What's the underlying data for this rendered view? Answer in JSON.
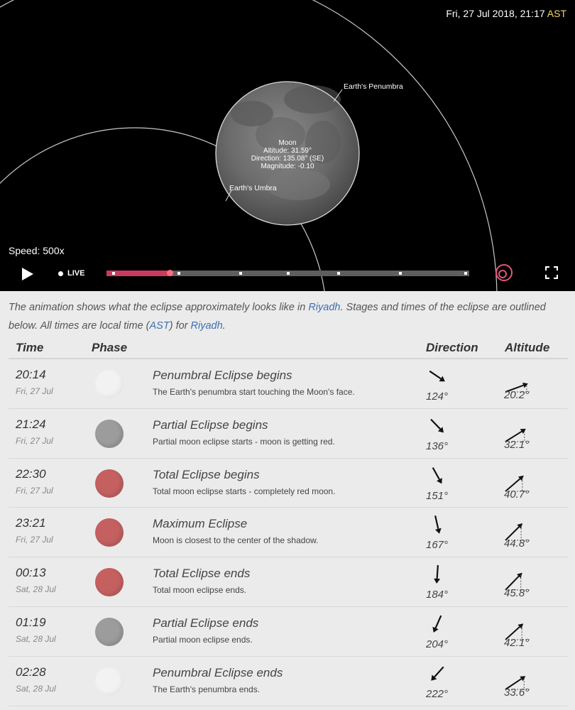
{
  "player": {
    "date_time": "Fri, 27 Jul 2018, 21:17",
    "timezone": "AST",
    "speed_label": "Speed: 500x",
    "live_label": "LIVE",
    "progress": 0.175,
    "timeline_ticks": [
      0.02,
      0.2,
      0.37,
      0.5,
      0.64,
      0.81,
      0.99
    ],
    "labels": {
      "penumbra": "Earth's Penumbra",
      "umbra": "Earth's Umbra",
      "moon_name": "Moon",
      "moon_altitude": "Altitude: 31.59°",
      "moon_direction": "Direction: 135.08° (SE)",
      "moon_magnitude": "Magnitude: -0.10"
    }
  },
  "intro": {
    "part1": "The animation shows what the eclipse approximately looks like in ",
    "link_city": "Riyadh",
    "part2": ". Stages and times of the eclipse are outlined below. All times are local time (",
    "link_tz": "AST",
    "part3": ") for ",
    "link_city2": "Riyadh",
    "part4": "."
  },
  "table": {
    "headers": {
      "time": "Time",
      "phase": "Phase",
      "direction": "Direction",
      "altitude": "Altitude"
    },
    "rows": [
      {
        "time": "20:14",
        "date": "Fri, 27 Jul",
        "phase": "penumbral",
        "name": "Penumbral Eclipse begins",
        "desc": "The Earth's penumbra start touching the Moon's face.",
        "direction": "124°",
        "dir_deg": 124,
        "altitude": "20.2°",
        "alt_deg": 20.2
      },
      {
        "time": "21:24",
        "date": "Fri, 27 Jul",
        "phase": "partial",
        "name": "Partial Eclipse begins",
        "desc": "Partial moon eclipse starts - moon is getting red.",
        "direction": "136°",
        "dir_deg": 136,
        "altitude": "32.1°",
        "alt_deg": 32.1
      },
      {
        "time": "22:30",
        "date": "Fri, 27 Jul",
        "phase": "total",
        "name": "Total Eclipse begins",
        "desc": "Total moon eclipse starts - completely red moon.",
        "direction": "151°",
        "dir_deg": 151,
        "altitude": "40.7°",
        "alt_deg": 40.7
      },
      {
        "time": "23:21",
        "date": "Fri, 27 Jul",
        "phase": "total",
        "name": "Maximum Eclipse",
        "desc": "Moon is closest to the center of the shadow.",
        "direction": "167°",
        "dir_deg": 167,
        "altitude": "44.8°",
        "alt_deg": 44.8
      },
      {
        "time": "00:13",
        "date": "Sat, 28 Jul",
        "phase": "total",
        "name": "Total Eclipse ends",
        "desc": "Total moon eclipse ends.",
        "direction": "184°",
        "dir_deg": 184,
        "altitude": "45.8°",
        "alt_deg": 45.8
      },
      {
        "time": "01:19",
        "date": "Sat, 28 Jul",
        "phase": "partial",
        "name": "Partial Eclipse ends",
        "desc": "Partial moon eclipse ends.",
        "direction": "204°",
        "dir_deg": 204,
        "altitude": "42.1°",
        "alt_deg": 42.1
      },
      {
        "time": "02:28",
        "date": "Sat, 28 Jul",
        "phase": "penumbral",
        "name": "Penumbral Eclipse ends",
        "desc": "The Earth's penumbra ends.",
        "direction": "222°",
        "dir_deg": 222,
        "altitude": "33.6°",
        "alt_deg": 33.6
      }
    ]
  },
  "colors": {
    "accent": "#c93a5f",
    "timezone": "#f3d86b",
    "link": "#3d6fb5",
    "phase_penumbral": "#f2f2f2",
    "phase_partial": "#9c9c9c",
    "phase_total": "#c56061"
  }
}
